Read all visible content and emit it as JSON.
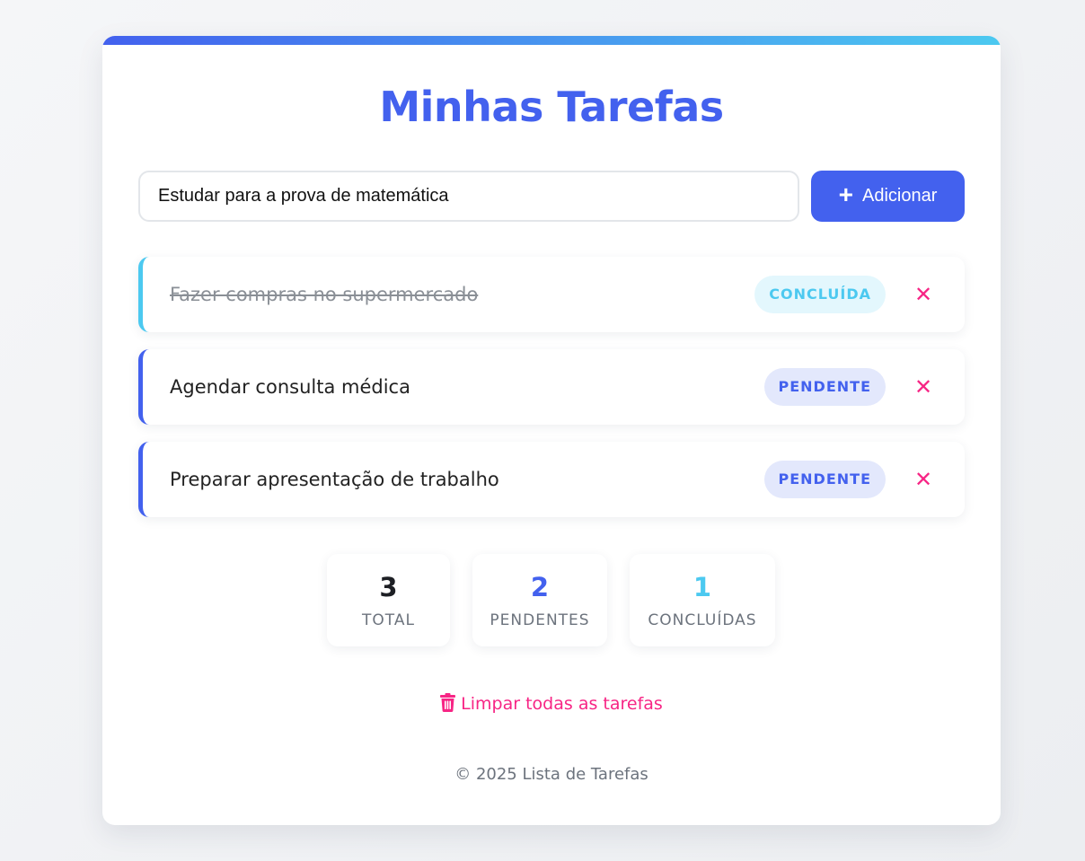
{
  "app": {
    "title": "Minhas Tarefas",
    "colors": {
      "primary": "#4361ee",
      "accent": "#4cc9f0",
      "danger": "#f72585"
    }
  },
  "input": {
    "value": "Estudar para a prova de matemática",
    "add_label": "Adicionar",
    "add_icon": "plus-icon"
  },
  "tasks": [
    {
      "text": "Fazer compras no supermercado",
      "status": "CONCLUÍDA",
      "done": true,
      "delete_icon": "close-icon"
    },
    {
      "text": "Agendar consulta médica",
      "status": "PENDENTE",
      "done": false,
      "delete_icon": "close-icon"
    },
    {
      "text": "Preparar apresentação de trabalho",
      "status": "PENDENTE",
      "done": false,
      "delete_icon": "close-icon"
    }
  ],
  "stats": {
    "total": {
      "value": "3",
      "label": "TOTAL"
    },
    "pending": {
      "value": "2",
      "label": "PENDENTES"
    },
    "completed": {
      "value": "1",
      "label": "CONCLUÍDAS"
    }
  },
  "clear": {
    "label": "Limpar todas as tarefas",
    "icon": "trash-icon"
  },
  "footer": {
    "text": "© 2025 Lista de Tarefas"
  }
}
